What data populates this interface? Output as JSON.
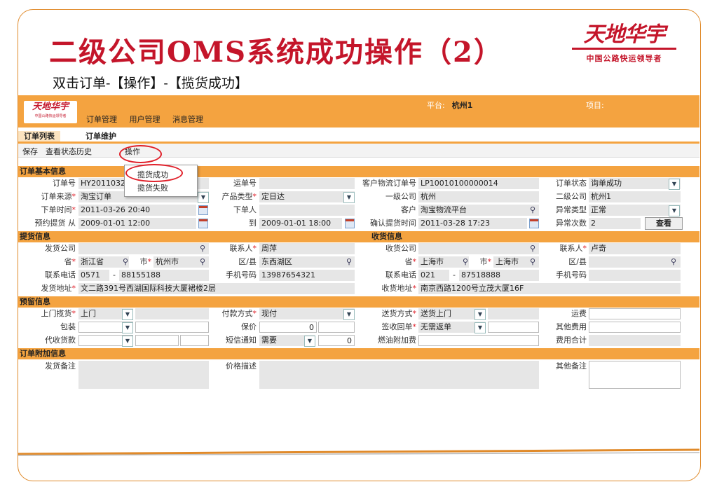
{
  "slide": {
    "title": "二级公司OMS系统成功操作（2）",
    "subtitle": "双击订单-【操作】-【揽货成功】",
    "brand_logo": "天地华宇",
    "brand_tagline": "中国公路快运领导者"
  },
  "app": {
    "logo": "天地华宇",
    "logo_tagline": "中国公路快运领导者",
    "menu": [
      "订单管理",
      "用户管理",
      "消息管理"
    ],
    "platform_label": "平台:",
    "platform_value": "杭州1",
    "project_label": "项目:",
    "tabs": [
      "订单列表",
      "订单维护"
    ],
    "toolbar": {
      "save": "保存",
      "history": "查看状态历史",
      "operate": "操作"
    },
    "popup": {
      "success": "揽货成功",
      "fail": "揽货失败"
    }
  },
  "basic": {
    "title": "订单基本信息",
    "order_no_label": "订单号",
    "order_no": "HY2011032",
    "waybill_label": "运单号",
    "waybill": "",
    "cust_order_label": "客户物流订单号",
    "cust_order": "LP10010100000014",
    "status_label": "订单状态",
    "status": "询单成功",
    "source_label": "订单来源",
    "source": "淘宝订单",
    "product_label": "产品类型",
    "product": "定日达",
    "first_co_label": "一级公司",
    "first_co": "杭州",
    "second_co_label": "二级公司",
    "second_co": "杭州1",
    "order_time_label": "下单时间",
    "order_time": "2011-03-26 20:40",
    "orderer_label": "下单人",
    "orderer": "",
    "customer_label": "客户",
    "customer": "淘宝物流平台",
    "abn_type_label": "异常类型",
    "abn_type": "正常",
    "pickup_from_label": "预约提货 从",
    "pickup_from": "2009-01-01 12:00",
    "pickup_to_label": "到",
    "pickup_to": "2009-01-01 18:00",
    "confirm_time_label": "确认提货时间",
    "confirm_time": "2011-03-28 17:23",
    "abn_count_label": "异常次数",
    "abn_count": "2",
    "view_btn": "查看"
  },
  "pickup": {
    "title": "提货信息",
    "company_label": "发货公司",
    "contact_label": "联系人",
    "contact": "周萍",
    "prov_label": "省",
    "prov": "浙江省",
    "city_label": "市",
    "city": "杭州市",
    "district_label": "区/县",
    "district": "东西湖区",
    "phone_label": "联系电话",
    "phone_area": "0571",
    "phone_sep": "-",
    "phone": "88155188",
    "mobile_label": "手机号码",
    "mobile": "13987654321",
    "addr_label": "发货地址",
    "addr": "文二路391号西湖国际科技大厦裙楼2层"
  },
  "receive": {
    "title": "收货信息",
    "company_label": "收货公司",
    "contact_label": "联系人",
    "contact": "卢奇",
    "prov_label": "省",
    "prov": "上海市",
    "city_label": "市",
    "city": "上海市",
    "district_label": "区/县",
    "phone_label": "联系电话",
    "phone_area": "021",
    "phone_sep": "-",
    "phone": "87518888",
    "mobile_label": "手机号码",
    "addr_label": "收货地址",
    "addr": "南京西路1200号立茂大厦16F"
  },
  "reserve": {
    "title": "预留信息",
    "door_label": "上门揽货",
    "door": "上门",
    "pay_label": "付款方式",
    "pay": "现付",
    "deliver_label": "送货方式",
    "deliver": "送货上门",
    "freight_label": "运费",
    "pack_label": "包装",
    "insure_label": "保价",
    "insure": "0",
    "receipt_label": "签收回单",
    "receipt": "无需返单",
    "other_fee_label": "其他费用",
    "cod_label": "代收货款",
    "sms_label": "短信通知",
    "sms": "需要",
    "sms_count": "0",
    "fuel_label": "燃油附加费",
    "total_label": "费用合计"
  },
  "extra": {
    "title": "订单附加信息",
    "send_note_label": "发货备注",
    "price_label": "价格描述",
    "other_note_label": "其他备注"
  }
}
